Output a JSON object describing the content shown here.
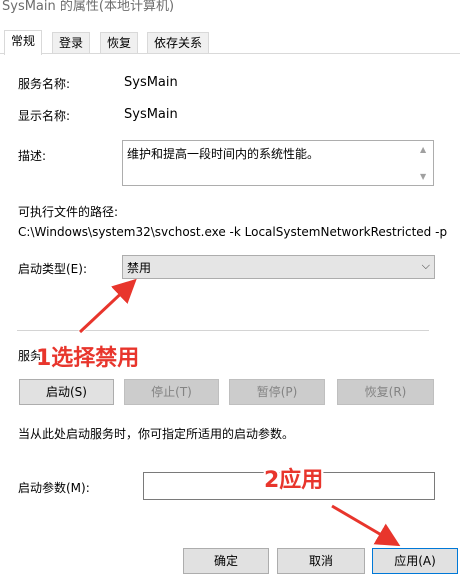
{
  "window": {
    "title": "SysMain 的属性(本地计算机)"
  },
  "tabs": [
    {
      "label": "常规",
      "active": true
    },
    {
      "label": "登录",
      "active": false
    },
    {
      "label": "恢复",
      "active": false
    },
    {
      "label": "依存关系",
      "active": false
    }
  ],
  "general": {
    "service_name_label": "服务名称:",
    "service_name": "SysMain",
    "display_name_label": "显示名称:",
    "display_name": "SysMain",
    "description_label": "描述:",
    "description": "维护和提高一段时间内的系统性能。",
    "exe_path_label": "可执行文件的路径:",
    "exe_path": "C:\\Windows\\system32\\svchost.exe -k LocalSystemNetworkRestricted -p",
    "startup_type_label": "启动类型(E):",
    "startup_type_value": "禁用",
    "service_status_label": "服务",
    "buttons": {
      "start": "启动(S)",
      "stop": "停止(T)",
      "pause": "暂停(P)",
      "resume": "恢复(R)"
    },
    "hint": "当从此处启动服务时，你可指定所适用的启动参数。",
    "start_params_label": "启动参数(M):",
    "start_params_value": ""
  },
  "footer": {
    "ok": "确定",
    "cancel": "取消",
    "apply": "应用(A)"
  },
  "annotations": {
    "step1": "1选择禁用",
    "step2": "2应用",
    "color": "#e8352c"
  },
  "icons": {
    "scroll_up": "triangle-up",
    "scroll_down": "triangle-down",
    "dropdown": "chevron-down"
  }
}
